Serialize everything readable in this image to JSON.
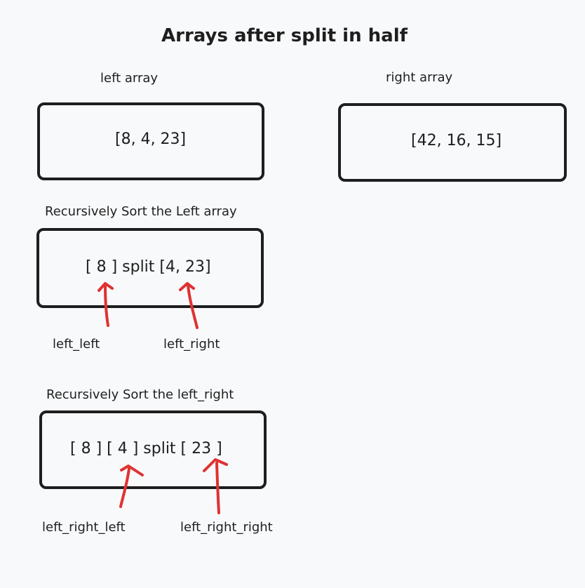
{
  "title": "Arrays after split in half",
  "labels": {
    "left_array": "left array",
    "right_array": "right array",
    "recursive_left": "Recursively Sort the Left array",
    "recursive_left_right": "Recursively Sort the left_right"
  },
  "boxes": {
    "left": "[8, 4, 23]",
    "right": "[42, 16, 15]",
    "split_left": "[ 8 ] split [4, 23]",
    "split_left_right": "[ 8 ] [ 4 ] split [ 23 ]"
  },
  "pointers": {
    "left_left": "left_left",
    "left_right": "left_right",
    "left_right_left": "left_right_left",
    "left_right_right": "left_right_right"
  },
  "colors": {
    "stroke": "#1e1e1e",
    "arrow": "#e03131",
    "background": "#f8f9fb"
  }
}
